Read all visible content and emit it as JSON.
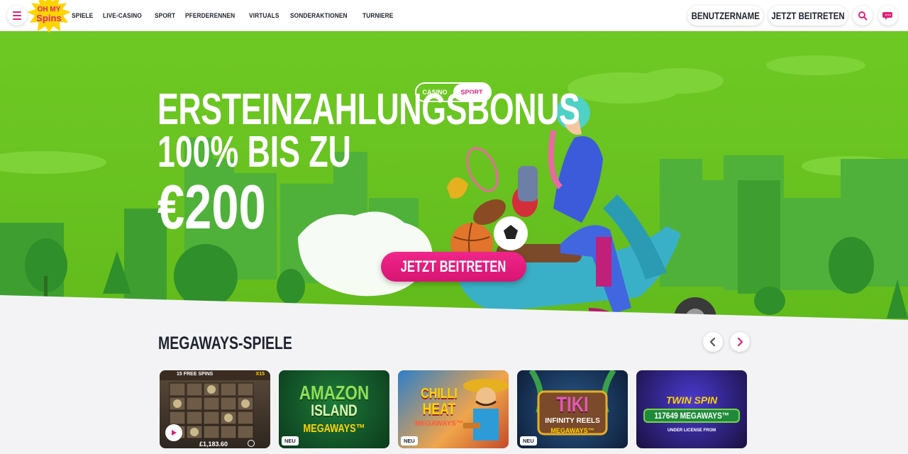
{
  "header": {
    "menu_icon": "hamburger-menu-icon",
    "logo_text": "OH MY SPINS",
    "nav": [
      "SPIELE",
      "LIVE-CASINO",
      "SPORT",
      "PFERDERENNEN",
      "VIRTUALS",
      "SONDERAKTIONEN",
      "TURNIERE"
    ],
    "username_label": "BENUTZERNAME",
    "join_label": "JETZT BEITRETEN",
    "search_icon": "search-icon",
    "chat_icon": "chat-icon",
    "accent_color": "#e0207a"
  },
  "hero": {
    "toggle": {
      "casino": "CASINO",
      "sport": "SPORT",
      "active": "sport"
    },
    "headline_1": "ERSTEINZAHLUNGSBONUS",
    "headline_2": "100% BIS ZU",
    "headline_3": "€200",
    "cta_label": "JETZT BEITRETEN",
    "background_color": "#6dc522"
  },
  "megaways": {
    "title": "MEGAWAYS-SPIELE",
    "prev_icon": "chevron-left-icon",
    "next_icon": "chevron-right-icon",
    "games": [
      {
        "name": "Bonanza-style slot",
        "top_text": "15 FREE SPINS",
        "multiplier": "X15",
        "amount": "£1,183.60",
        "badge": ""
      },
      {
        "name": "Amazon Island Megaways",
        "line1": "AMAZON",
        "line2": "ISLAND",
        "line3": "MEGAWAYS™",
        "badge": "NEU"
      },
      {
        "name": "Chilli Heat Megaways",
        "line1": "CHILLI",
        "line2": "HEAT",
        "line3": "MEGAWAYS™",
        "badge": "NEU"
      },
      {
        "name": "Tiki Infinity Reels Megaways",
        "line1": "TIKI",
        "line2": "INFINITY REELS",
        "line3": "MEGAWAYS™",
        "badge": "NEU"
      },
      {
        "name": "Twin Spin Megaways",
        "line1": "TWIN SPIN",
        "line2": "117649 MEGAWAYS™",
        "line3": "UNDER LICENSE FROM",
        "badge": ""
      }
    ]
  }
}
